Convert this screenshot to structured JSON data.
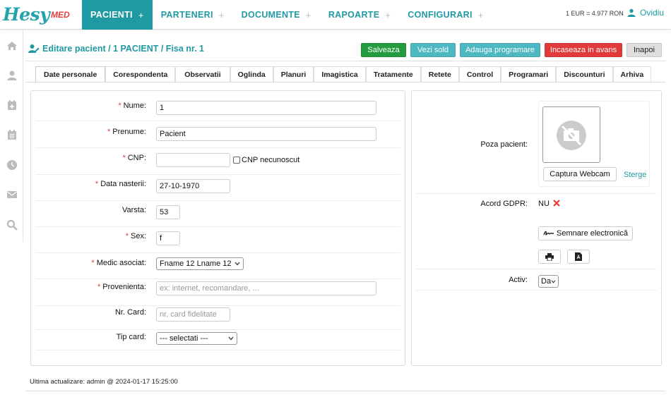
{
  "brand": {
    "name": "Hesy",
    "suffix": "MED"
  },
  "nav": [
    {
      "label": "PACIENTI",
      "plus": "+",
      "active": true
    },
    {
      "label": "PARTENERI",
      "plus": "+"
    },
    {
      "label": "DOCUMENTE",
      "plus": "+"
    },
    {
      "label": "RAPOARTE",
      "plus": "+"
    },
    {
      "label": "CONFIGURARI",
      "plus": "+"
    }
  ],
  "rate": "1 EUR = 4.977 RON",
  "user": "Ovidiu",
  "sidebar_icons": [
    "home-icon",
    "user-icon",
    "calendar-plus-icon",
    "calendar-icon",
    "clock-icon",
    "envelope-icon",
    "search-icon"
  ],
  "page": {
    "title": "Editare pacient / 1 PACIENT / Fisa nr. 1"
  },
  "actions": {
    "save": "Salveaza",
    "balance": "Vezi sold",
    "schedule": "Adauga programare",
    "advance": "Incaseaza in avans",
    "back": "Inapoi"
  },
  "tabs": [
    "Date personale",
    "Corespondenta",
    "Observatii",
    "Oglinda",
    "Planuri",
    "Imagistica",
    "Tratamente",
    "Retete",
    "Control",
    "Programari",
    "Discounturi",
    "Arhiva"
  ],
  "form": {
    "nume": {
      "label": "Nume:",
      "value": "1"
    },
    "prenume": {
      "label": "Prenume:",
      "value": "Pacient"
    },
    "cnp": {
      "label": "CNP:",
      "value": "",
      "unknown_label": "CNP necunoscut"
    },
    "data_nasterii": {
      "label": "Data nasterii:",
      "value": "27-10-1970"
    },
    "varsta": {
      "label": "Varsta:",
      "value": "53"
    },
    "sex": {
      "label": "Sex:",
      "value": "f"
    },
    "medic": {
      "label": "Medic asociat:",
      "value": "Fname 12 Lname 12"
    },
    "provenienta": {
      "label": "Provenienta:",
      "placeholder": "ex: internet, recomandare, ..."
    },
    "nr_card": {
      "label": "Nr. Card:",
      "placeholder": "nr. card fidelitate"
    },
    "tip_card": {
      "label": "Tip card:",
      "value": "--- selectati ---"
    }
  },
  "side": {
    "photo_label": "Poza pacient:",
    "webcam": "Captura Webcam",
    "delete": "Sterge",
    "gdpr_label": "Acord GDPR:",
    "gdpr_value": "NU",
    "sign": "Semnare electronică",
    "active_label": "Activ:",
    "active_value": "Da"
  },
  "footer": "Ultima actualizare: admin @ 2024-01-17 15:25:00",
  "colors": {
    "teal": "#1f9aa2",
    "green": "#239b3e",
    "red": "#e23a3a",
    "light_teal": "#4db8c2"
  }
}
